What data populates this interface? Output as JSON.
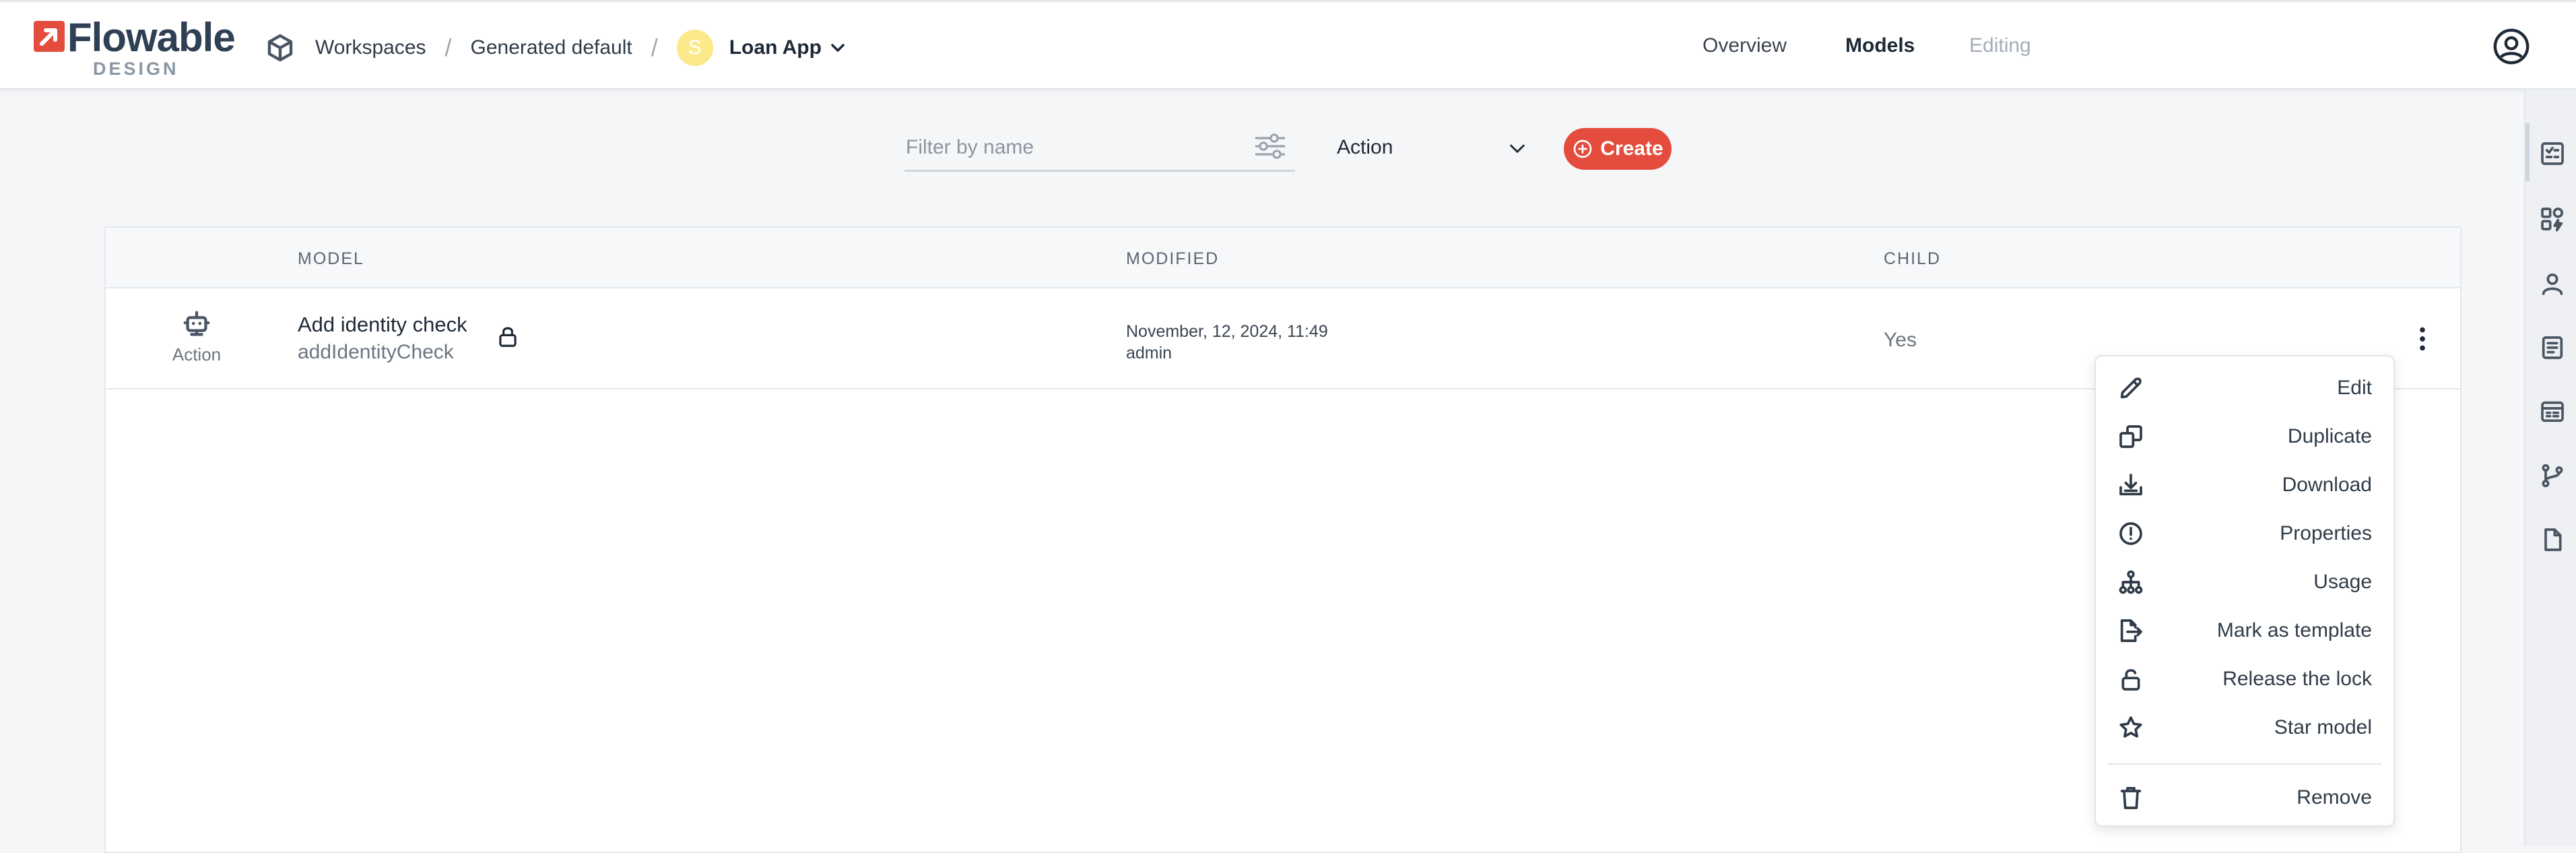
{
  "brand": {
    "word": "Flowable",
    "sub": "DESIGN",
    "accent": "#e44c3d"
  },
  "breadcrumb": {
    "workspaces": "Workspaces",
    "workspace": "Generated default",
    "app_initial": "S",
    "app_name": "Loan App"
  },
  "topnav": {
    "overview": "Overview",
    "models": "Models",
    "editing": "Editing"
  },
  "filter": {
    "placeholder": "Filter by name",
    "value": ""
  },
  "type_select": {
    "value": "Action"
  },
  "create_button": {
    "label": "Create"
  },
  "table": {
    "headers": {
      "model": "MODEL",
      "modified": "MODIFIED",
      "child": "CHILD"
    },
    "rows": [
      {
        "type_label": "Action",
        "name": "Add identity check",
        "key": "addIdentityCheck",
        "modified_date": "November, 12, 2024, 11:49",
        "modified_by": "admin",
        "child": "Yes"
      }
    ]
  },
  "context_menu": {
    "items": [
      {
        "label": "Edit",
        "icon": "pencil-icon"
      },
      {
        "label": "Duplicate",
        "icon": "duplicate-icon"
      },
      {
        "label": "Download",
        "icon": "download-icon"
      },
      {
        "label": "Properties",
        "icon": "info-circle-icon"
      },
      {
        "label": "Usage",
        "icon": "hierarchy-icon"
      },
      {
        "label": "Mark as template",
        "icon": "file-export-icon"
      },
      {
        "label": "Release the lock",
        "icon": "unlock-icon"
      },
      {
        "label": "Star model",
        "icon": "star-icon"
      },
      {
        "label": "Remove",
        "icon": "trash-icon"
      }
    ]
  },
  "right_rail": {
    "icons": [
      "models-list-icon",
      "components-icon",
      "user-icon",
      "document-list-icon",
      "form-icon",
      "branch-icon",
      "file-icon"
    ]
  }
}
